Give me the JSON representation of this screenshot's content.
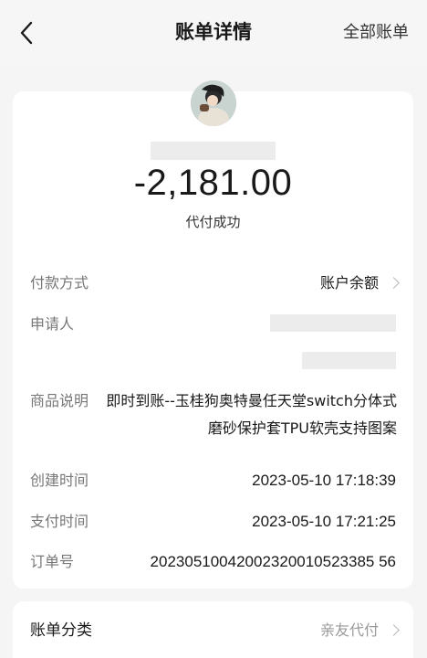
{
  "nav": {
    "title": "账单详情",
    "right_link": "全部账单"
  },
  "summary": {
    "amount": "-2,181.00",
    "status": "代付成功"
  },
  "details": {
    "payment_method_label": "付款方式",
    "payment_method_value": "账户余额",
    "applicant_label": "申请人",
    "product_label": "商品说明",
    "product_value": "即时到账--玉桂狗奥特曼任天堂switch分体式磨砂保护套TPU软壳支持图案",
    "created_label": "创建时间",
    "created_value": "2023-05-10 17:18:39",
    "paid_label": "支付时间",
    "paid_value": "2023-05-10 17:21:25",
    "order_label": "订单号",
    "order_value": "20230510042002320010523385 56"
  },
  "category": {
    "label": "账单分类",
    "value": "亲友代付"
  },
  "icons": {
    "back": "chevron-left-icon",
    "row_arrow": "chevron-right-icon"
  }
}
